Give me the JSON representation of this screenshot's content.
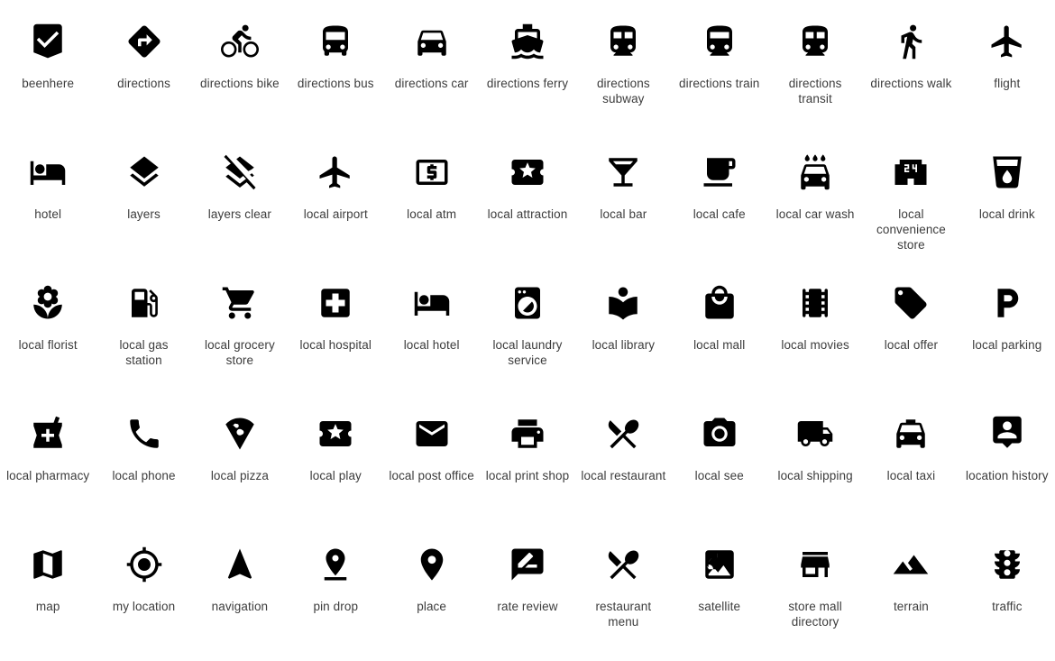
{
  "page": {
    "title": "Maps Icons",
    "background_color": "#ffffff",
    "icon_color": "#000000",
    "label_color": "#3c3c3c",
    "columns": 11,
    "rows": 5,
    "total_icons": 55
  },
  "icons": [
    {
      "id": "beenhere",
      "label": "beenhere",
      "row": 1,
      "col": 1
    },
    {
      "id": "directions",
      "label": "directions",
      "row": 1,
      "col": 2
    },
    {
      "id": "directions-bike",
      "label": "directions bike",
      "row": 1,
      "col": 3
    },
    {
      "id": "directions-bus",
      "label": "directions bus",
      "row": 1,
      "col": 4
    },
    {
      "id": "directions-car",
      "label": "directions car",
      "row": 1,
      "col": 5
    },
    {
      "id": "directions-ferry",
      "label": "directions ferry",
      "row": 1,
      "col": 6
    },
    {
      "id": "directions-subway",
      "label": "directions subway",
      "row": 1,
      "col": 7
    },
    {
      "id": "directions-train",
      "label": "directions train",
      "row": 1,
      "col": 8
    },
    {
      "id": "directions-transit",
      "label": "directions transit",
      "row": 1,
      "col": 9
    },
    {
      "id": "directions-walk",
      "label": "directions walk",
      "row": 1,
      "col": 10
    },
    {
      "id": "flight",
      "label": "flight",
      "row": 1,
      "col": 11
    },
    {
      "id": "hotel",
      "label": "hotel",
      "row": 2,
      "col": 1
    },
    {
      "id": "layers",
      "label": "layers",
      "row": 2,
      "col": 2
    },
    {
      "id": "layers-clear",
      "label": "layers clear",
      "row": 2,
      "col": 3
    },
    {
      "id": "local-airport",
      "label": "local airport",
      "row": 2,
      "col": 4
    },
    {
      "id": "local-atm",
      "label": "local atm",
      "row": 2,
      "col": 5
    },
    {
      "id": "local-attraction",
      "label": "local attraction",
      "row": 2,
      "col": 6
    },
    {
      "id": "local-bar",
      "label": "local bar",
      "row": 2,
      "col": 7
    },
    {
      "id": "local-cafe",
      "label": "local cafe",
      "row": 2,
      "col": 8
    },
    {
      "id": "local-car-wash",
      "label": "local car wash",
      "row": 2,
      "col": 9
    },
    {
      "id": "local-convenience-store",
      "label": "local convenience store",
      "row": 2,
      "col": 10
    },
    {
      "id": "local-drink",
      "label": "local drink",
      "row": 2,
      "col": 11
    },
    {
      "id": "local-florist",
      "label": "local florist",
      "row": 3,
      "col": 1
    },
    {
      "id": "local-gas-station",
      "label": "local gas station",
      "row": 3,
      "col": 2
    },
    {
      "id": "local-grocery-store",
      "label": "local grocery store",
      "row": 3,
      "col": 3
    },
    {
      "id": "local-hospital",
      "label": "local hospital",
      "row": 3,
      "col": 4
    },
    {
      "id": "local-hotel",
      "label": "local hotel",
      "row": 3,
      "col": 5
    },
    {
      "id": "local-laundry-service",
      "label": "local laundry service",
      "row": 3,
      "col": 6
    },
    {
      "id": "local-library",
      "label": "local library",
      "row": 3,
      "col": 7
    },
    {
      "id": "local-mall",
      "label": "local mall",
      "row": 3,
      "col": 8
    },
    {
      "id": "local-movies",
      "label": "local movies",
      "row": 3,
      "col": 9
    },
    {
      "id": "local-offer",
      "label": "local offer",
      "row": 3,
      "col": 10
    },
    {
      "id": "local-parking",
      "label": "local parking",
      "row": 3,
      "col": 11
    },
    {
      "id": "local-pharmacy",
      "label": "local pharmacy",
      "row": 4,
      "col": 1
    },
    {
      "id": "local-phone",
      "label": "local phone",
      "row": 4,
      "col": 2
    },
    {
      "id": "local-pizza",
      "label": "local pizza",
      "row": 4,
      "col": 3
    },
    {
      "id": "local-play",
      "label": "local play",
      "row": 4,
      "col": 4
    },
    {
      "id": "local-post-office",
      "label": "local post office",
      "row": 4,
      "col": 5
    },
    {
      "id": "local-print-shop",
      "label": "local print shop",
      "row": 4,
      "col": 6
    },
    {
      "id": "local-restaurant",
      "label": "local restaurant",
      "row": 4,
      "col": 7
    },
    {
      "id": "local-see",
      "label": "local see",
      "row": 4,
      "col": 8
    },
    {
      "id": "local-shipping",
      "label": "local shipping",
      "row": 4,
      "col": 9
    },
    {
      "id": "local-taxi",
      "label": "local taxi",
      "row": 4,
      "col": 10
    },
    {
      "id": "location-history",
      "label": "location history",
      "row": 4,
      "col": 11
    },
    {
      "id": "map",
      "label": "map",
      "row": 5,
      "col": 1
    },
    {
      "id": "my-location",
      "label": "my location",
      "row": 5,
      "col": 2
    },
    {
      "id": "navigation",
      "label": "navigation",
      "row": 5,
      "col": 3
    },
    {
      "id": "pin-drop",
      "label": "pin drop",
      "row": 5,
      "col": 4
    },
    {
      "id": "place",
      "label": "place",
      "row": 5,
      "col": 5
    },
    {
      "id": "rate-review",
      "label": "rate review",
      "row": 5,
      "col": 6
    },
    {
      "id": "restaurant-menu",
      "label": "restaurant menu",
      "row": 5,
      "col": 7
    },
    {
      "id": "satellite",
      "label": "satellite",
      "row": 5,
      "col": 8
    },
    {
      "id": "store-mall-directory",
      "label": "store mall directory",
      "row": 5,
      "col": 9
    },
    {
      "id": "terrain",
      "label": "terrain",
      "row": 5,
      "col": 10
    },
    {
      "id": "traffic",
      "label": "traffic",
      "row": 5,
      "col": 11
    }
  ],
  "icon_glyph_text": {
    "local-convenience-store": "24",
    "local-atm": "$",
    "local-parking": "P"
  }
}
